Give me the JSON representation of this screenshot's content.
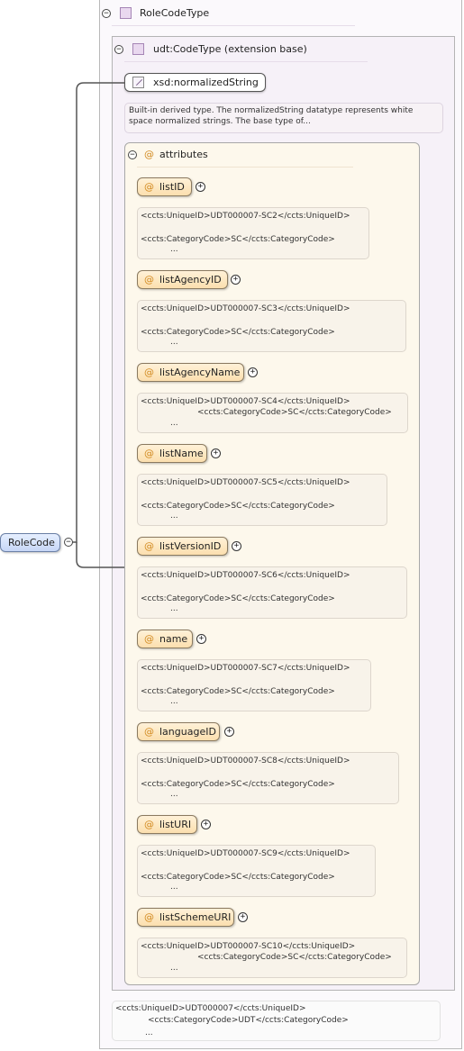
{
  "complex_type": {
    "name": "RoleCodeType",
    "extension_label": "udt:CodeType (extension base)",
    "simple_type": "xsd:normalizedString",
    "simple_type_doc_line1": "Built-in derived type. The normalizedString datatype represents white",
    "simple_type_doc_line2": "space normalized strings. The base type of...",
    "attributes_label": "attributes"
  },
  "element": {
    "name": "RoleCode"
  },
  "attributes": [
    {
      "name": "listID",
      "unique": "<ccts:UniqueID>UDT000007-SC2</ccts:UniqueID>",
      "category": "<ccts:CategoryCode>SC</ccts:CategoryCode>",
      "more": "..."
    },
    {
      "name": "listAgencyID",
      "unique": "<ccts:UniqueID>UDT000007-SC3</ccts:UniqueID>",
      "category": "<ccts:CategoryCode>SC</ccts:CategoryCode>",
      "more": "..."
    },
    {
      "name": "listAgencyName",
      "unique": "<ccts:UniqueID>UDT000007-SC4</ccts:UniqueID>",
      "category": "<ccts:CategoryCode>SC</ccts:CategoryCode>",
      "more": "..."
    },
    {
      "name": "listName",
      "unique": "<ccts:UniqueID>UDT000007-SC5</ccts:UniqueID>",
      "category": "<ccts:CategoryCode>SC</ccts:CategoryCode>",
      "more": "..."
    },
    {
      "name": "listVersionID",
      "unique": "<ccts:UniqueID>UDT000007-SC6</ccts:UniqueID>",
      "category": "<ccts:CategoryCode>SC</ccts:CategoryCode>",
      "more": "..."
    },
    {
      "name": "name",
      "unique": "<ccts:UniqueID>UDT000007-SC7</ccts:UniqueID>",
      "category": "<ccts:CategoryCode>SC</ccts:CategoryCode>",
      "more": "..."
    },
    {
      "name": "languageID",
      "unique": "<ccts:UniqueID>UDT000007-SC8</ccts:UniqueID>",
      "category": "<ccts:CategoryCode>SC</ccts:CategoryCode>",
      "more": "..."
    },
    {
      "name": "listURI",
      "unique": "<ccts:UniqueID>UDT000007-SC9</ccts:UniqueID>",
      "category": "<ccts:CategoryCode>SC</ccts:CategoryCode>",
      "more": "..."
    },
    {
      "name": "listSchemeURI",
      "unique": "<ccts:UniqueID>UDT000007-SC10</ccts:UniqueID>",
      "category": "<ccts:CategoryCode>SC</ccts:CategoryCode>",
      "more": "..."
    }
  ],
  "bottom_doc": {
    "unique": "<ccts:UniqueID>UDT000007</ccts:UniqueID>",
    "category": "<ccts:CategoryCode>UDT</ccts:CategoryCode>",
    "more": "..."
  },
  "toggles": {
    "collapse": "−",
    "expand": "+"
  }
}
